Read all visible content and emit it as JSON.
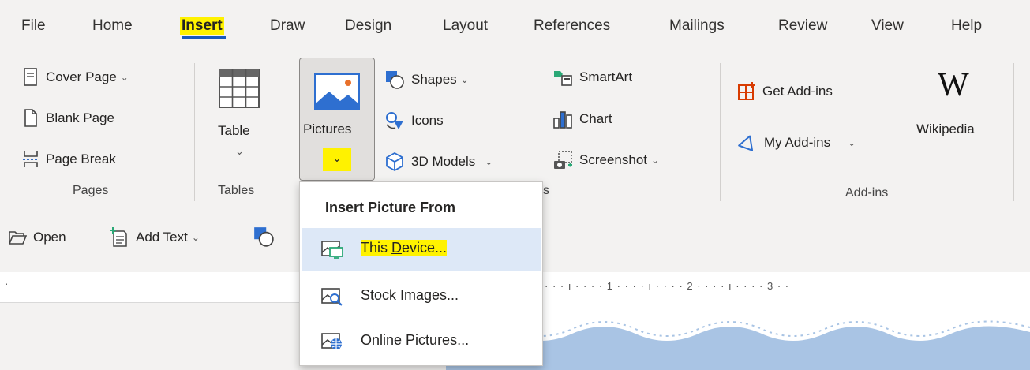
{
  "tabs": [
    "File",
    "Home",
    "Insert",
    "Draw",
    "Design",
    "Layout",
    "References",
    "Mailings",
    "Review",
    "View",
    "Help"
  ],
  "active_tab": "Insert",
  "ribbon": {
    "pages": {
      "cover_page": "Cover Page",
      "blank_page": "Blank Page",
      "page_break": "Page Break",
      "group": "Pages"
    },
    "tables": {
      "table": "Table",
      "group": "Tables"
    },
    "illustrations": {
      "pictures": "Pictures",
      "shapes": "Shapes",
      "icons": "Icons",
      "models": "3D Models",
      "smartart": "SmartArt",
      "chart": "Chart",
      "screenshot": "Screenshot",
      "group_tail": "s"
    },
    "addins": {
      "get": "Get Add-ins",
      "my": "My Add-ins",
      "wikipedia": "Wikipedia",
      "wikipedia_logo": "W",
      "group": "Add-ins"
    }
  },
  "quickbar": {
    "open": "Open",
    "add_text": "Add Text"
  },
  "ruler": "· · · ı · · · · 1 · · · · ı · · · · 2 · · · · ı · · · · 3 · ·",
  "menu": {
    "header": "Insert Picture From",
    "items": [
      {
        "label_pre": "This ",
        "label_u": "D",
        "label_post": "evice..."
      },
      {
        "label_pre": "",
        "label_u": "S",
        "label_post": "tock Images..."
      },
      {
        "label_pre": "",
        "label_u": "O",
        "label_post": "nline Pictures..."
      }
    ]
  },
  "colors": {
    "accent": "#185abd",
    "highlight": "#fff200",
    "hover": "#dde8f7"
  }
}
